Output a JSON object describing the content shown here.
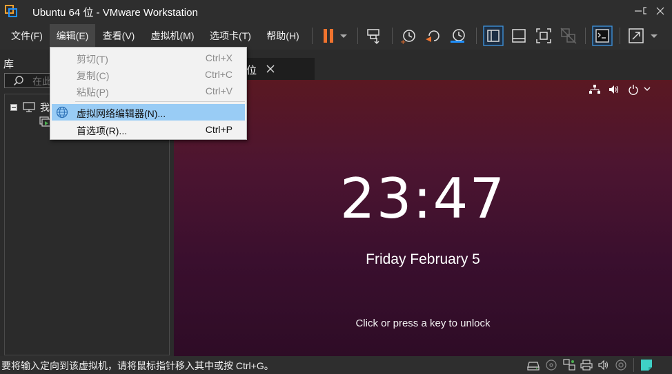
{
  "window": {
    "title": "Ubuntu 64 位 - VMware Workstation",
    "controls": [
      "minimize-icon",
      "maximize-icon",
      "close-icon"
    ]
  },
  "menubar": {
    "items": [
      "文件(F)",
      "编辑(E)",
      "查看(V)",
      "虚拟机(M)",
      "选项卡(T)",
      "帮助(H)"
    ],
    "active_index": 1
  },
  "toolbar": {
    "icons": [
      "pause-icon",
      "dropdown-arrow-icon",
      "send-ctrl-alt-del-icon",
      "snapshot-icon",
      "revert-snapshot-icon",
      "snapshot-manager-icon",
      "show-library-icon",
      "thumbnail-bar-icon",
      "full-screen-icon",
      "unity-icon",
      "console-view-icon",
      "stretch-guest-icon",
      "dropdown-arrow-icon"
    ]
  },
  "library": {
    "title": "库",
    "search_placeholder": "在此",
    "tree": [
      {
        "label": "我",
        "icon": "computer-icon"
      },
      {
        "label": "",
        "icon": "vm-running-icon"
      }
    ]
  },
  "tab": {
    "label": "位",
    "close_icon": "close-icon"
  },
  "edit_menu": {
    "items": [
      {
        "label": "剪切(T)",
        "shortcut": "Ctrl+X",
        "enabled": false
      },
      {
        "label": "复制(C)",
        "shortcut": "Ctrl+C",
        "enabled": false
      },
      {
        "label": "粘贴(P)",
        "shortcut": "Ctrl+V",
        "enabled": false
      },
      {
        "label": "虚拟网络编辑器(N)...",
        "shortcut": "",
        "enabled": true,
        "highlighted": true,
        "icon": "globe-icon"
      },
      {
        "label": "首选项(R)...",
        "shortcut": "Ctrl+P",
        "enabled": true
      }
    ]
  },
  "vm_screen": {
    "time": "23:47",
    "date": "Friday February 5",
    "hint": "Click or press a key to unlock",
    "system_icons": [
      "network-icon",
      "volume-icon",
      "power-icon",
      "chevron-down-icon"
    ]
  },
  "statusbar": {
    "message": "要将输入定向到该虚拟机，请将鼠标指针移入其中或按 Ctrl+G。",
    "icons": [
      "hard-disk-icon",
      "cd-drive-icon",
      "network-adapter-icon",
      "printer-icon",
      "sound-card-icon",
      "display-icon",
      "notes-icon"
    ]
  },
  "colors": {
    "accent": "#1e90ff",
    "pause_orange": "#f0732e",
    "menu_highlight": "#99ccf5",
    "vm_bg_top": "#5a1822",
    "vm_bg_bottom": "#2e0c26"
  }
}
